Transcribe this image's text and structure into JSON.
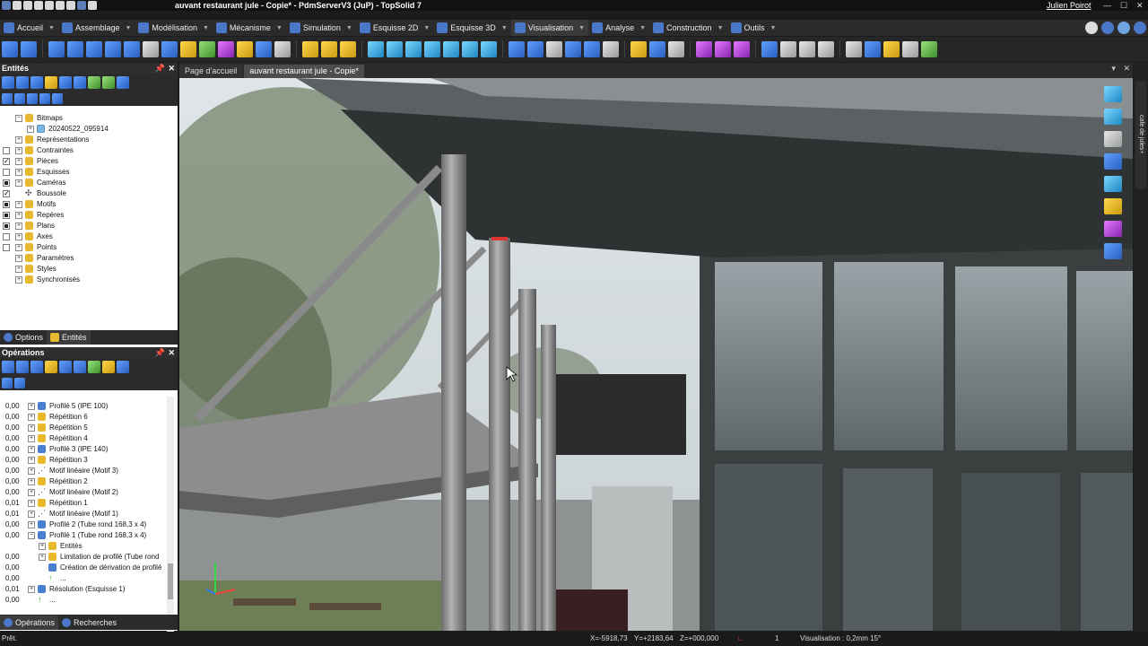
{
  "window": {
    "title": "auvant restaurant jule - Copie* - PdmServerV3 (JuP) - TopSolid 7",
    "user": "Julien Poirot"
  },
  "ribbon_tabs": [
    {
      "label": "Accueil",
      "icon": "home-icon"
    },
    {
      "label": "Assemblage",
      "icon": "assembly-icon"
    },
    {
      "label": "Modélisation",
      "icon": "modeling-icon"
    },
    {
      "label": "Mécanisme",
      "icon": "mechanism-icon"
    },
    {
      "label": "Simulation",
      "icon": "simulation-icon"
    },
    {
      "label": "Esquisse 2D",
      "icon": "sketch2d-icon"
    },
    {
      "label": "Esquisse 3D",
      "icon": "sketch3d-icon"
    },
    {
      "label": "Visualisation",
      "icon": "visualization-icon",
      "active": true
    },
    {
      "label": "Analyse",
      "icon": "analysis-icon"
    },
    {
      "label": "Construction",
      "icon": "construction-icon"
    },
    {
      "label": "Outils",
      "icon": "tools-icon"
    }
  ],
  "entities_panel": {
    "title": "Entités",
    "tree": [
      {
        "label": "Bitmaps",
        "indent": 0,
        "expanded": true,
        "check": "none",
        "icon": "folder"
      },
      {
        "label": "20240522_095914",
        "indent": 1,
        "check": "none",
        "icon": "img"
      },
      {
        "label": "Représentations",
        "indent": 0,
        "check": "none",
        "icon": "folder"
      },
      {
        "label": "Contraintes",
        "indent": 0,
        "check": "box",
        "icon": "folder"
      },
      {
        "label": "Pièces",
        "indent": 0,
        "check": "on",
        "icon": "folder"
      },
      {
        "label": "Esquisses",
        "indent": 0,
        "check": "box",
        "icon": "folder"
      },
      {
        "label": "Caméras",
        "indent": 0,
        "check": "sq",
        "icon": "folder"
      },
      {
        "label": "Boussole",
        "indent": 0,
        "check": "on",
        "icon": "comp",
        "noexp": true
      },
      {
        "label": "Motifs",
        "indent": 0,
        "check": "sq",
        "icon": "folder"
      },
      {
        "label": "Repères",
        "indent": 0,
        "check": "sq",
        "icon": "folder"
      },
      {
        "label": "Plans",
        "indent": 0,
        "check": "sq",
        "icon": "folder"
      },
      {
        "label": "Axes",
        "indent": 0,
        "check": "box",
        "icon": "folder"
      },
      {
        "label": "Points",
        "indent": 0,
        "check": "box",
        "icon": "folder"
      },
      {
        "label": "Paramètres",
        "indent": 0,
        "check": "none",
        "icon": "folder"
      },
      {
        "label": "Styles",
        "indent": 0,
        "check": "none",
        "icon": "folder"
      },
      {
        "label": "Synchronisés",
        "indent": 0,
        "check": "none",
        "icon": "folder"
      }
    ]
  },
  "panel_tabs_top": [
    {
      "label": "Options",
      "active": false
    },
    {
      "label": "Entités",
      "active": true
    }
  ],
  "operations_panel": {
    "title": "Opérations",
    "tree": [
      {
        "value": "0,00",
        "label": "Profilé 5 (IPE 100)",
        "indent": 0,
        "icon": "blue"
      },
      {
        "value": "0,00",
        "label": "Répétition 6",
        "indent": 0,
        "icon": "folder"
      },
      {
        "value": "0,00",
        "label": "Répétition 5",
        "indent": 0,
        "icon": "folder"
      },
      {
        "value": "0,00",
        "label": "Répétition 4",
        "indent": 0,
        "icon": "folder"
      },
      {
        "value": "0,00",
        "label": "Profilé 3 (IPE 140)",
        "indent": 0,
        "icon": "blue"
      },
      {
        "value": "0,00",
        "label": "Répétition 3",
        "indent": 0,
        "icon": "folder"
      },
      {
        "value": "0,00",
        "label": "Motif linéaire (Motif 3)",
        "indent": 0,
        "icon": "dots"
      },
      {
        "value": "0,00",
        "label": "Répétition 2",
        "indent": 0,
        "icon": "folder"
      },
      {
        "value": "0,00",
        "label": "Motif linéaire (Motif 2)",
        "indent": 0,
        "icon": "dots"
      },
      {
        "value": "0,01",
        "label": "Répétition 1",
        "indent": 0,
        "icon": "folder"
      },
      {
        "value": "0,01",
        "label": "Motif linéaire (Motif 1)",
        "indent": 0,
        "icon": "dots"
      },
      {
        "value": "0,00",
        "label": "Profilé 2 (Tube rond  168,3 x 4)",
        "indent": 0,
        "icon": "blue"
      },
      {
        "value": "0,00",
        "label": "Profilé 1 (Tube rond  168,3 x 4)",
        "indent": 0,
        "icon": "blue",
        "expanded": true
      },
      {
        "value": "",
        "label": "Entités",
        "indent": 1,
        "icon": "folder"
      },
      {
        "value": "0,00",
        "label": "Limitation de profilé (Tube rond",
        "indent": 1,
        "icon": "folder"
      },
      {
        "value": "0,00",
        "label": "Création de dérivation de profilé",
        "indent": 1,
        "icon": "blue",
        "noexp": true
      },
      {
        "value": "0,00",
        "label": "...",
        "indent": 1,
        "icon": "arrow",
        "noexp": true
      },
      {
        "value": "0,01",
        "label": "Résolution (Esquisse 1)",
        "indent": 0,
        "icon": "blue"
      },
      {
        "value": "0,00",
        "label": "...",
        "indent": 0,
        "icon": "arrow",
        "noexp": true
      }
    ]
  },
  "panel_tabs_bottom": [
    {
      "label": "Opérations",
      "active": true
    },
    {
      "label": "Recherches",
      "active": false
    }
  ],
  "document_tabs": [
    {
      "label": "Page d'accueil",
      "active": false
    },
    {
      "label": "auvant restaurant jule - Copie*",
      "active": true
    }
  ],
  "side_tab_label": "cafe de jules+",
  "status_bar": {
    "state": "Prêt.",
    "x": "X=-5918,73",
    "y": "Y=+2183,64",
    "z": "Z=+000,000",
    "count": "1",
    "visualization": "Visualisation : 0,2mm 15°"
  },
  "colors": {
    "accent": "#4a77c8",
    "folder": "#e8b92d",
    "panel_bg": "#ffffff",
    "chrome_bg": "#2b2b2b"
  }
}
